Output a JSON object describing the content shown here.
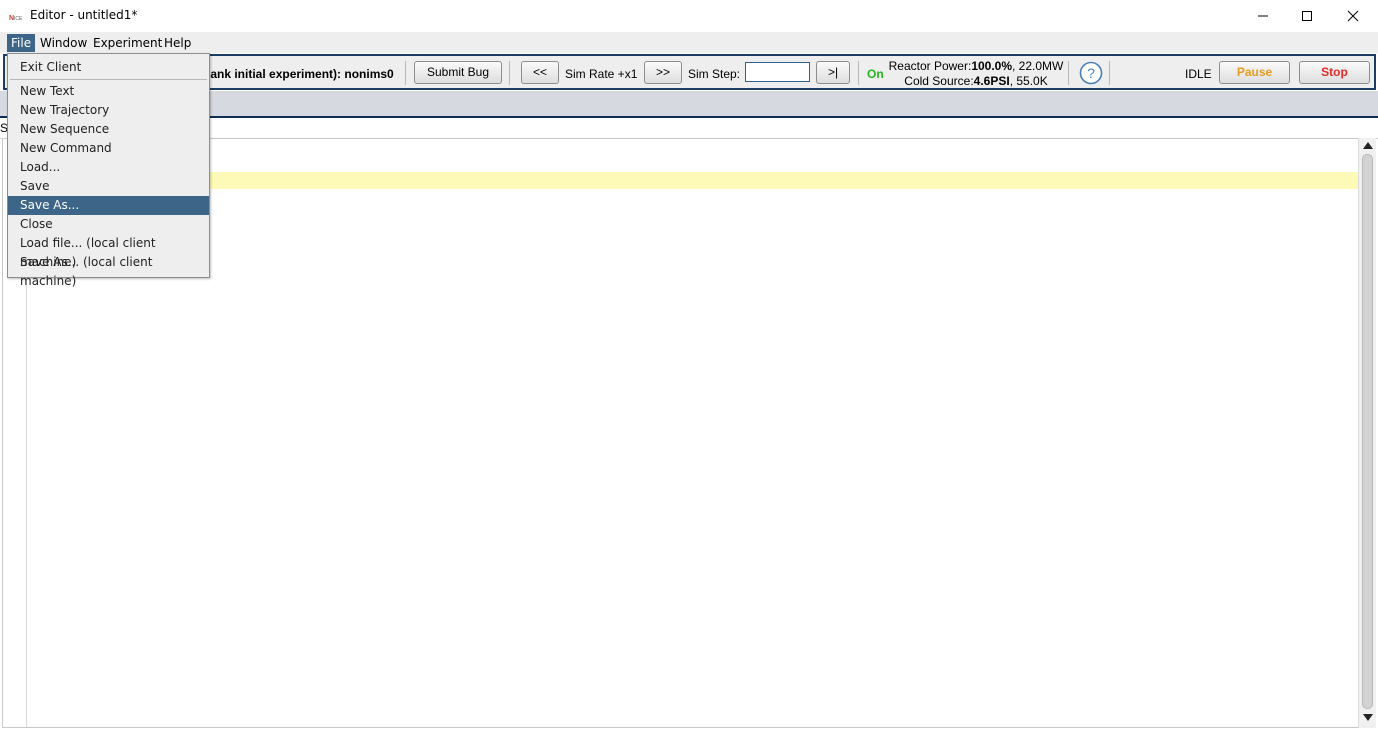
{
  "window": {
    "title": "Editor - untitled1*",
    "logo_text": "NICE"
  },
  "menubar": {
    "items": [
      "File",
      "Window",
      "Experiment",
      "Help"
    ]
  },
  "toolbar": {
    "experiment_label": "lank initial experiment): nonims0",
    "submit_bug": "Submit Bug",
    "rewind": "<<",
    "sim_rate": "Sim Rate +x1",
    "forward": ">>",
    "sim_step_label": "Sim Step:",
    "sim_step_value": "",
    "step_button": ">|",
    "on_status": "On",
    "reactor_power_label": "Reactor Power:",
    "reactor_power_value": "100.0%",
    "reactor_power_mw": ", 22.0MW",
    "cold_source_label": "Cold Source:",
    "cold_source_psi": "4.6PSI",
    "cold_source_k": ", 55.0K",
    "idle": "IDLE",
    "pause": "Pause",
    "stop": "Stop"
  },
  "tabs": {
    "partial_label": "S"
  },
  "file_menu": {
    "items": [
      {
        "label": "Exit Client"
      },
      {
        "label": "New Text"
      },
      {
        "label": "New Trajectory"
      },
      {
        "label": "New Sequence"
      },
      {
        "label": "New Command"
      },
      {
        "label": "Load..."
      },
      {
        "label": "Save"
      },
      {
        "label": "Save As..."
      },
      {
        "label": "Close"
      },
      {
        "label": "Load file... (local client machine)"
      },
      {
        "label": "Save As... (local client machine)"
      }
    ],
    "selected": "Save As..."
  },
  "colors": {
    "menu_highlight": "#3c6587",
    "toolbar_border": "#1b3d63",
    "on_green": "#21b421",
    "pause_orange": "#e59b1f",
    "stop_red": "#e22a2a",
    "current_line": "#fdfab8"
  }
}
